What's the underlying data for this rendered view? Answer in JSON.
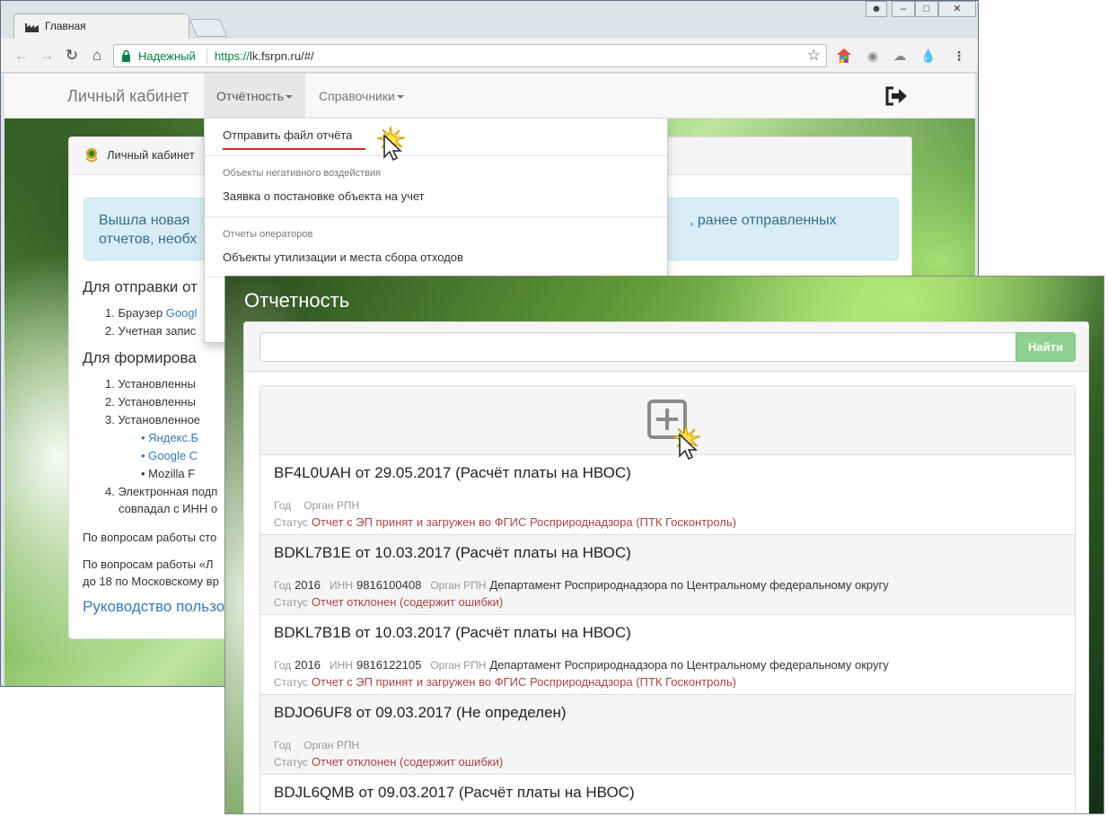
{
  "browser": {
    "tab_title": "Главная",
    "secure_label": "Надежный",
    "url_scheme": "https://",
    "url_rest": "lk.fsrpn.ru/#/"
  },
  "site": {
    "brand": "Личный кабинет",
    "nav_reports": "Отчётность",
    "nav_refs": "Справочники",
    "panel_heading": "Личный кабинет",
    "alert_line1_left": "Вышла новая",
    "alert_line1_right": ", ранее отправленных",
    "alert_line2_left": "отчетов, необх",
    "h_send": "Для отправки от",
    "send_items": [
      "1. Браузер",
      "2. Учетная запис"
    ],
    "send_link": "Googl",
    "h_form": "Для формирова",
    "form_items": [
      "1. Установленны",
      "2. Установленны",
      "3. Установленное"
    ],
    "form_browsers": [
      "Яндекс.Б",
      "Google C",
      "Mozilla F"
    ],
    "item4_line1": "4. Электронная подп",
    "item4_line2": "совпадал с ИНН о",
    "support_1": "По вопросам работы сто",
    "support_2a": "По вопросам работы «Л",
    "support_2b": "до 18 по Московскому вр",
    "guide": "Руководство пользо"
  },
  "dropdown": {
    "send_file": "Отправить файл отчёта",
    "header_negative": "Объекты негативного воздействия",
    "registration": "Заявка о постановке объекта на учет",
    "header_operators": "Отчеты операторов",
    "utilization": "Объекты утилизации и места сбора отходов"
  },
  "overlay": {
    "title": "Отчетность",
    "search_value": "",
    "search_button": "Найти",
    "labels": {
      "year": "Год",
      "inn": "ИНН",
      "organ": "Орган РПН",
      "status": "Статус"
    },
    "reports": [
      {
        "title": "BF4L0UAH от 29.05.2017 (Расчёт платы на НВОС)",
        "year": "",
        "inn": "",
        "organ": "",
        "status": "Отчет с ЭП принят и загружен во ФГИС Росприроднадзора (ПТК Госконтроль)"
      },
      {
        "title": "BDKL7B1E от 10.03.2017 (Расчёт платы на НВОС)",
        "year": "2016",
        "inn": "9816100408",
        "organ": "Департамент Росприроднадзора по Центральному федеральному округу",
        "status": "Отчет отклонен (содержит ошибки)"
      },
      {
        "title": "BDKL7B1B от 10.03.2017 (Расчёт платы на НВОС)",
        "year": "2016",
        "inn": "9816122105",
        "organ": "Департамент Росприроднадзора по Центральному федеральному округу",
        "status": "Отчет с ЭП принят и загружен во ФГИС Росприроднадзора (ПТК Госконтроль)"
      },
      {
        "title": "BDJO6UF8 от 09.03.2017 (Не определен)",
        "year": "",
        "inn": "",
        "organ": "",
        "status": "Отчет отклонен (содержит ошибки)"
      },
      {
        "title": "BDJL6QMB от 09.03.2017 (Расчёт платы на НВОС)",
        "year": "",
        "inn": "",
        "organ": "",
        "status": ""
      }
    ]
  }
}
